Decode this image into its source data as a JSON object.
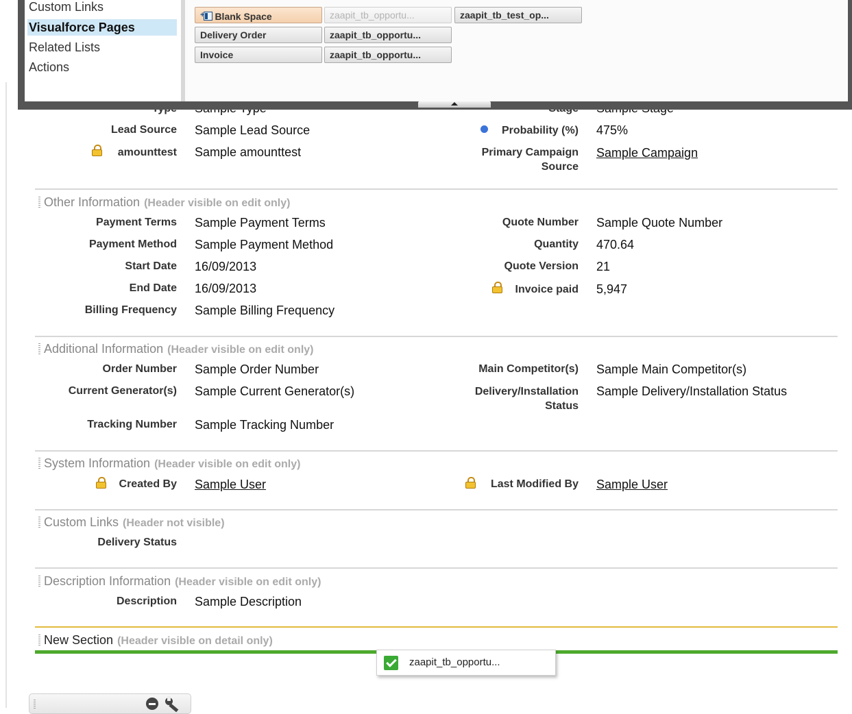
{
  "palette": {
    "categories": [
      "Custom Links",
      "Visualforce Pages",
      "Related Lists",
      "Actions"
    ],
    "selected_category": "Visualforce Pages",
    "items": [
      {
        "label": "Blank Space"
      },
      {
        "label": "zaapit_tb_opportu..."
      },
      {
        "label": "zaapit_tb_test_op..."
      },
      {
        "label": "Delivery Order"
      },
      {
        "label": "zaapit_tb_opportu..."
      },
      {
        "label": "Invoice"
      },
      {
        "label": "zaapit_tb_opportu..."
      }
    ]
  },
  "partial_row": {
    "label_left": "Type",
    "value_left": "Sample Type",
    "label_right": "Stage",
    "value_right": "Sample Stage"
  },
  "opportunity_fields": {
    "lead_source_label": "Lead Source",
    "lead_source_value": "Sample Lead Source",
    "amounttest_label": "amounttest",
    "amounttest_value": "Sample amounttest",
    "probability_label": "Probability (%)",
    "probability_value": "475%",
    "campaign_label_1": "Primary Campaign",
    "campaign_label_2": "Source",
    "campaign_value": "Sample Campaign"
  },
  "other_info": {
    "title": "Other Information",
    "note": "(Header visible on edit only)",
    "payment_terms_label": "Payment Terms",
    "payment_terms_value": "Sample Payment Terms",
    "payment_method_label": "Payment Method",
    "payment_method_value": "Sample Payment Method",
    "start_date_label": "Start Date",
    "start_date_value": "16/09/2013",
    "end_date_label": "End Date",
    "end_date_value": "16/09/2013",
    "billing_label": "Billing Frequency",
    "billing_value": "Sample Billing Frequency",
    "quote_number_label": "Quote Number",
    "quote_number_value": "Sample Quote Number",
    "quantity_label": "Quantity",
    "quantity_value": "470.64",
    "quote_version_label": "Quote Version",
    "quote_version_value": "21",
    "invoice_paid_label": "Invoice paid",
    "invoice_paid_value": "5,947"
  },
  "additional_info": {
    "title": "Additional Information",
    "note": "(Header visible on edit only)",
    "order_number_label": "Order Number",
    "order_number_value": "Sample Order Number",
    "current_gen_label": "Current Generator(s)",
    "current_gen_value": "Sample Current Generator(s)",
    "tracking_label": "Tracking Number",
    "tracking_value": "Sample Tracking Number",
    "competitor_label": "Main Competitor(s)",
    "competitor_value": "Sample Main Competitor(s)",
    "delivery_label_1": "Delivery/Installation",
    "delivery_label_2": "Status",
    "delivery_value": "Sample Delivery/Installation Status"
  },
  "system_info": {
    "title": "System Information",
    "note": "(Header visible on edit only)",
    "created_by_label": "Created By",
    "created_by_value": "Sample User",
    "modified_by_label": "Last Modified By",
    "modified_by_value": "Sample User"
  },
  "custom_links": {
    "title": "Custom Links",
    "note": "(Header not visible)",
    "delivery_status_label": "Delivery Status"
  },
  "description_info": {
    "title": "Description Information",
    "note": "(Header visible on edit only)",
    "description_label": "Description",
    "description_value": "Sample Description"
  },
  "new_section": {
    "title": "New Section",
    "note": "(Header visible on detail only)"
  },
  "drag_chip": {
    "label": "zaapit_tb_opportu..."
  },
  "colors": {
    "palette_frame": "#555555",
    "selected_category": "#cfe8f7",
    "blank_space_button": "#f4d0ad",
    "new_section_top": "#e3bb3d",
    "new_section_bottom": "#4da92d",
    "check_green": "#3aaa35",
    "lock_gold": "#f2c230",
    "required_dot": "#3b73d9"
  }
}
